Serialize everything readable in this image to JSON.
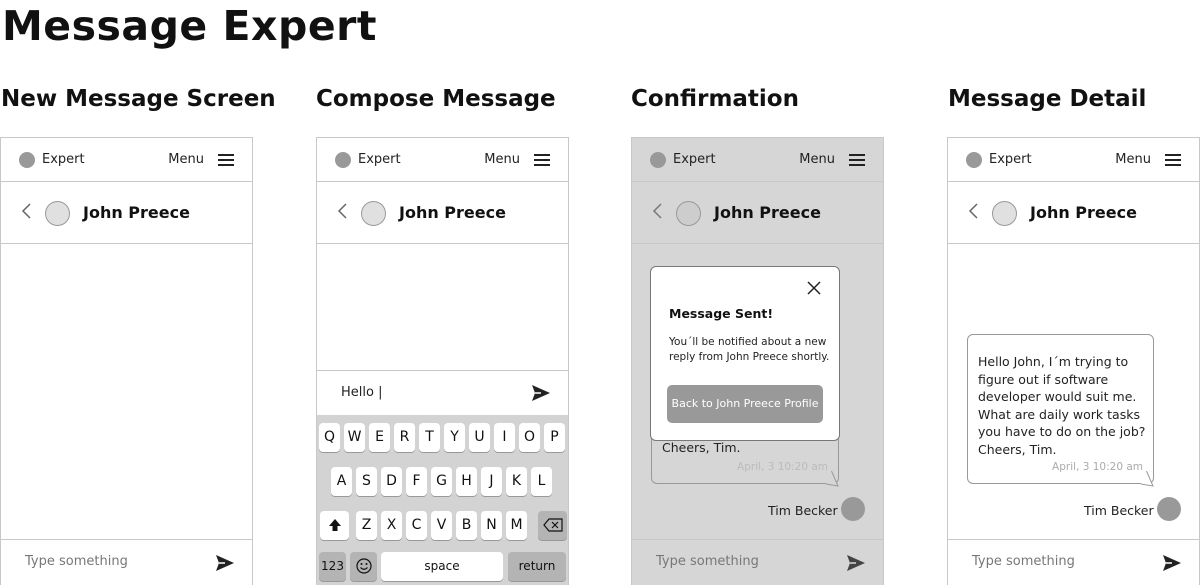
{
  "page_title": "Message Expert",
  "screens": [
    {
      "title": "New Message Screen"
    },
    {
      "title": "Compose Message"
    },
    {
      "title": "Confirmation"
    },
    {
      "title": "Message Detail"
    }
  ],
  "topbar": {
    "brand": "Expert",
    "menu_label": "Menu"
  },
  "contact": {
    "name": "John Preece"
  },
  "input": {
    "placeholder": "Type something"
  },
  "compose": {
    "text": "Hello |"
  },
  "keyboard": {
    "row1": [
      "Q",
      "W",
      "E",
      "R",
      "T",
      "Y",
      "U",
      "I",
      "O",
      "P"
    ],
    "row2": [
      "A",
      "S",
      "D",
      "F",
      "G",
      "H",
      "J",
      "K",
      "L"
    ],
    "row3": [
      "Z",
      "X",
      "C",
      "V",
      "B",
      "N",
      "M"
    ],
    "numbers_key": "123",
    "space_key": "space",
    "return_key": "return"
  },
  "confirmation": {
    "title": "Message Sent!",
    "body": "You´ll be notified about a new reply from John Preece shortly.",
    "button": "Back to John Preece Profile",
    "visible_message_tail": "Cheers, Tim."
  },
  "message": {
    "text_lines": [
      "Hello John, I´m trying to",
      "figure out if software",
      "developer would suit me.",
      "What are daily work tasks",
      "you have to do on the job?",
      "Cheers, Tim."
    ],
    "timestamp": "April, 3 10:20 am",
    "sender": "Tim Becker"
  },
  "icons": [
    "logo-dot-icon",
    "hamburger-menu-icon",
    "chevron-left-icon",
    "avatar-icon",
    "send-icon",
    "close-icon",
    "shift-icon",
    "backspace-icon",
    "emoji-icon"
  ],
  "colors": {
    "border": "#c8c8c8",
    "dim_overlay": "#d6d6d6",
    "button_gray": "#999999",
    "keyboard_bg": "#d3d3d3"
  }
}
